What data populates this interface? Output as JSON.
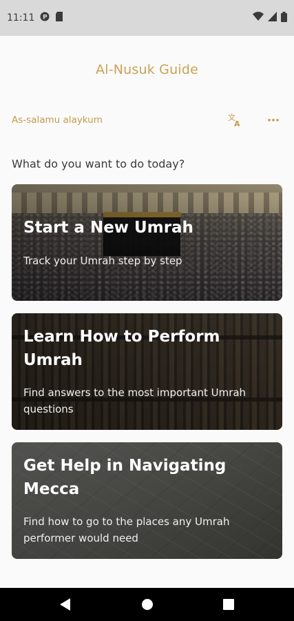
{
  "status_bar": {
    "time": "11:11",
    "icons": [
      "notification-p-icon",
      "sd-card-icon",
      "wifi-icon",
      "signal-icon",
      "battery-icon"
    ]
  },
  "app": {
    "title": "Al-Nusuk Guide",
    "accent_color": "#c9a255"
  },
  "header": {
    "greeting": "As-salamu alaykum",
    "actions": [
      "translate-icon",
      "more-icon"
    ]
  },
  "main": {
    "prompt": "What do you want to do today?",
    "cards": [
      {
        "title": "Start a New Umrah",
        "description": "Track your Umrah step by step",
        "image": "kaaba-crowd-image"
      },
      {
        "title": "Learn How to Perform Umrah",
        "description": "Find answers to the most important Umrah questions",
        "image": "library-books-image"
      },
      {
        "title": "Get Help in Navigating Mecca",
        "description": "Find how to go to the places any Umrah performer would need",
        "image": "map-image"
      }
    ]
  },
  "nav": {
    "buttons": [
      "back-icon",
      "home-icon",
      "recents-icon"
    ]
  }
}
